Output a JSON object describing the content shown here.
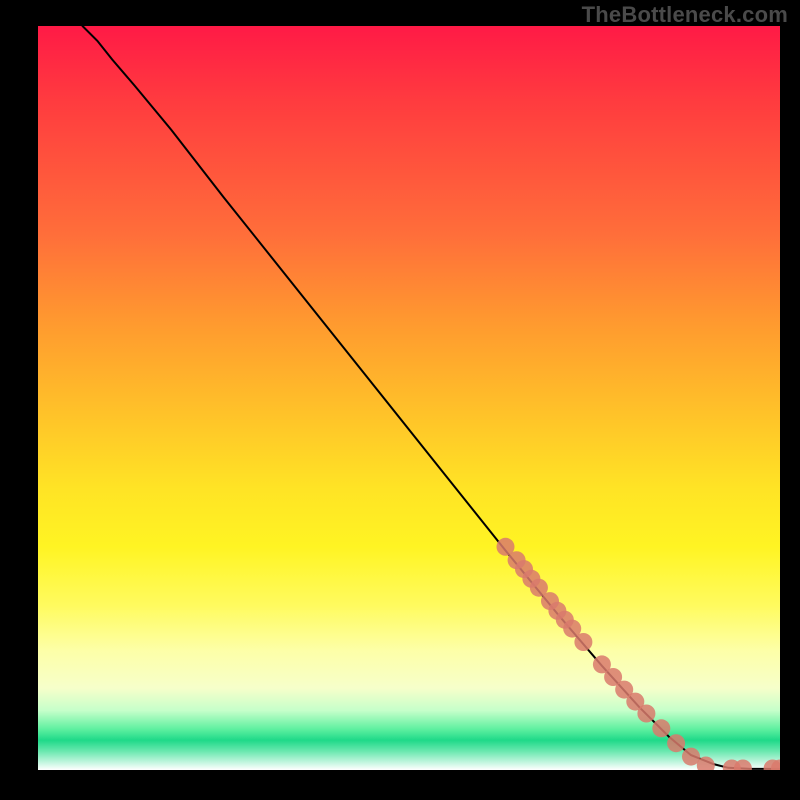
{
  "watermark": "TheBottleneck.com",
  "chart_data": {
    "type": "line",
    "title": "",
    "xlabel": "",
    "ylabel": "",
    "xlim": [
      0,
      100
    ],
    "ylim": [
      0,
      100
    ],
    "grid": false,
    "legend": false,
    "series": [
      {
        "name": "curve",
        "style": "line",
        "color": "#000000",
        "x": [
          6,
          8,
          10,
          13,
          18,
          25,
          35,
          45,
          55,
          63,
          70,
          76,
          81,
          85,
          88,
          91,
          93,
          96,
          100
        ],
        "y": [
          100,
          98,
          95.5,
          92,
          86,
          77,
          64.5,
          52,
          39.5,
          29.5,
          21,
          14,
          8.5,
          4.5,
          2,
          0.8,
          0.3,
          0.15,
          0.15
        ]
      },
      {
        "name": "markers",
        "style": "scatter",
        "color": "#d97a6c",
        "points": [
          {
            "x": 63,
            "y": 30
          },
          {
            "x": 64.5,
            "y": 28.2
          },
          {
            "x": 65.5,
            "y": 27
          },
          {
            "x": 66.5,
            "y": 25.7
          },
          {
            "x": 67.5,
            "y": 24.5
          },
          {
            "x": 69,
            "y": 22.7
          },
          {
            "x": 70,
            "y": 21.4
          },
          {
            "x": 71,
            "y": 20.2
          },
          {
            "x": 72,
            "y": 19
          },
          {
            "x": 73.5,
            "y": 17.2
          },
          {
            "x": 76,
            "y": 14.2
          },
          {
            "x": 77.5,
            "y": 12.5
          },
          {
            "x": 79,
            "y": 10.8
          },
          {
            "x": 80.5,
            "y": 9.2
          },
          {
            "x": 82,
            "y": 7.6
          },
          {
            "x": 84,
            "y": 5.6
          },
          {
            "x": 86,
            "y": 3.6
          },
          {
            "x": 88,
            "y": 1.8
          },
          {
            "x": 90,
            "y": 0.6
          },
          {
            "x": 93.5,
            "y": 0.2
          },
          {
            "x": 95,
            "y": 0.2
          },
          {
            "x": 99,
            "y": 0.2
          },
          {
            "x": 100,
            "y": 0.2
          }
        ]
      }
    ]
  }
}
